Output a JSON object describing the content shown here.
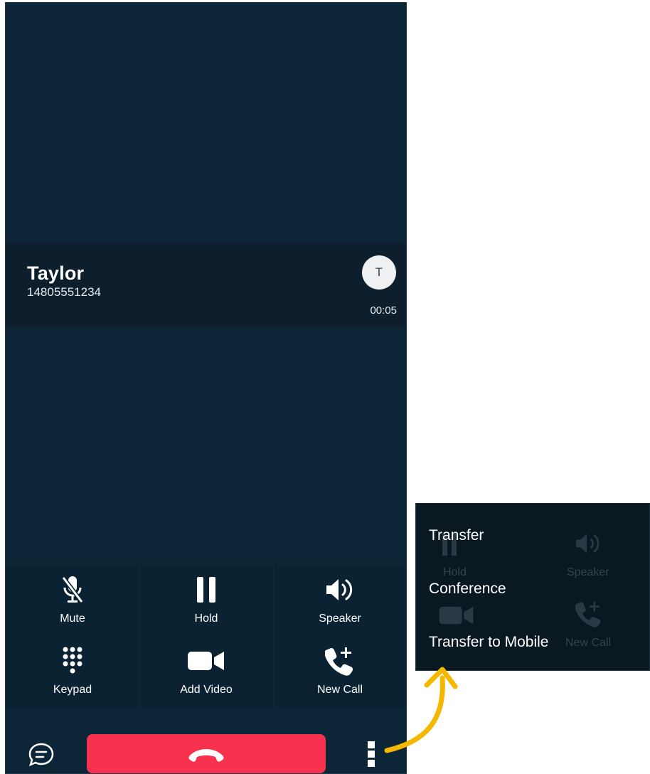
{
  "contact": {
    "name": "Taylor",
    "number": "14805551234",
    "avatar_initial": "T",
    "timer": "00:05"
  },
  "controls": [
    {
      "label": "Mute",
      "icon": "mic-off-icon"
    },
    {
      "label": "Hold",
      "icon": "pause-icon"
    },
    {
      "label": "Speaker",
      "icon": "speaker-icon"
    },
    {
      "label": "Keypad",
      "icon": "keypad-icon"
    },
    {
      "label": "Add Video",
      "icon": "video-camera-icon"
    },
    {
      "label": "New Call",
      "icon": "phone-add-icon"
    }
  ],
  "bottom": {
    "chat_icon": "chat-icon",
    "end_call_icon": "phone-hangup-icon",
    "more_icon": "more-vertical-icon"
  },
  "popup": {
    "items": [
      "Transfer",
      "Conference",
      "Transfer to Mobile"
    ],
    "background_labels": [
      "Hold",
      "Speaker",
      "New Call"
    ]
  },
  "colors": {
    "background": "#0c2638",
    "contact_bar": "#0d1f2d",
    "end_call": "#f6324e",
    "arrow": "#f5b800"
  }
}
